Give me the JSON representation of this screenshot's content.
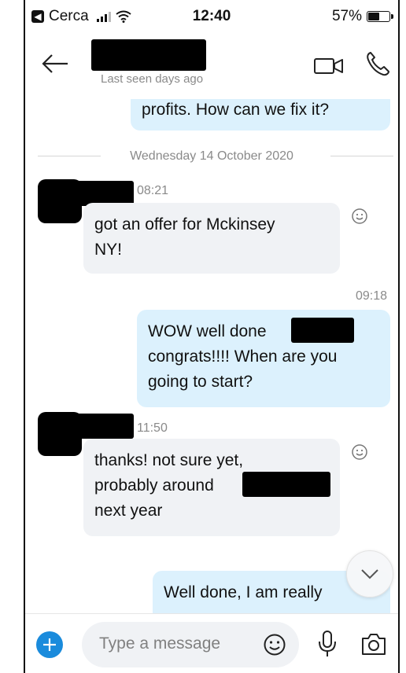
{
  "status_bar": {
    "back_app_label": "Cerca",
    "time": "12:40",
    "battery_percent": "57%",
    "battery_level": 0.57
  },
  "header": {
    "last_seen": "Last seen days ago"
  },
  "chat": {
    "messages": [
      {
        "direction": "outgoing",
        "text": "profits. How can we fix it?"
      },
      {
        "type": "date_separator",
        "text": "Wednesday 14 October 2020"
      },
      {
        "direction": "incoming",
        "time": "08:21",
        "text_lines": [
          "got an offer for Mckinsey",
          "NY!"
        ]
      },
      {
        "direction": "outgoing",
        "time": "09:18",
        "text_lines": [
          "WOW well done",
          "congrats!!!! When are you",
          "going to start?"
        ]
      },
      {
        "direction": "incoming",
        "time": "11:50",
        "text_lines": [
          "thanks! not sure yet,",
          "probably around",
          "next year"
        ]
      },
      {
        "direction": "outgoing",
        "text": "Well done, I am really"
      }
    ]
  },
  "composer": {
    "placeholder": "Type a message"
  },
  "icons": {
    "back": "arrow-left-icon",
    "video_call": "video-camera-icon",
    "voice_call": "phone-icon",
    "scroll_down": "chevron-down-icon",
    "add": "plus-icon",
    "emoji": "smiley-icon",
    "mic": "microphone-icon",
    "camera": "camera-icon"
  },
  "colors": {
    "outgoing_bubble": "#dcf1fd",
    "incoming_bubble": "#f0f2f5",
    "accent": "#1a8bdc",
    "muted_text": "#8a8a8a"
  }
}
